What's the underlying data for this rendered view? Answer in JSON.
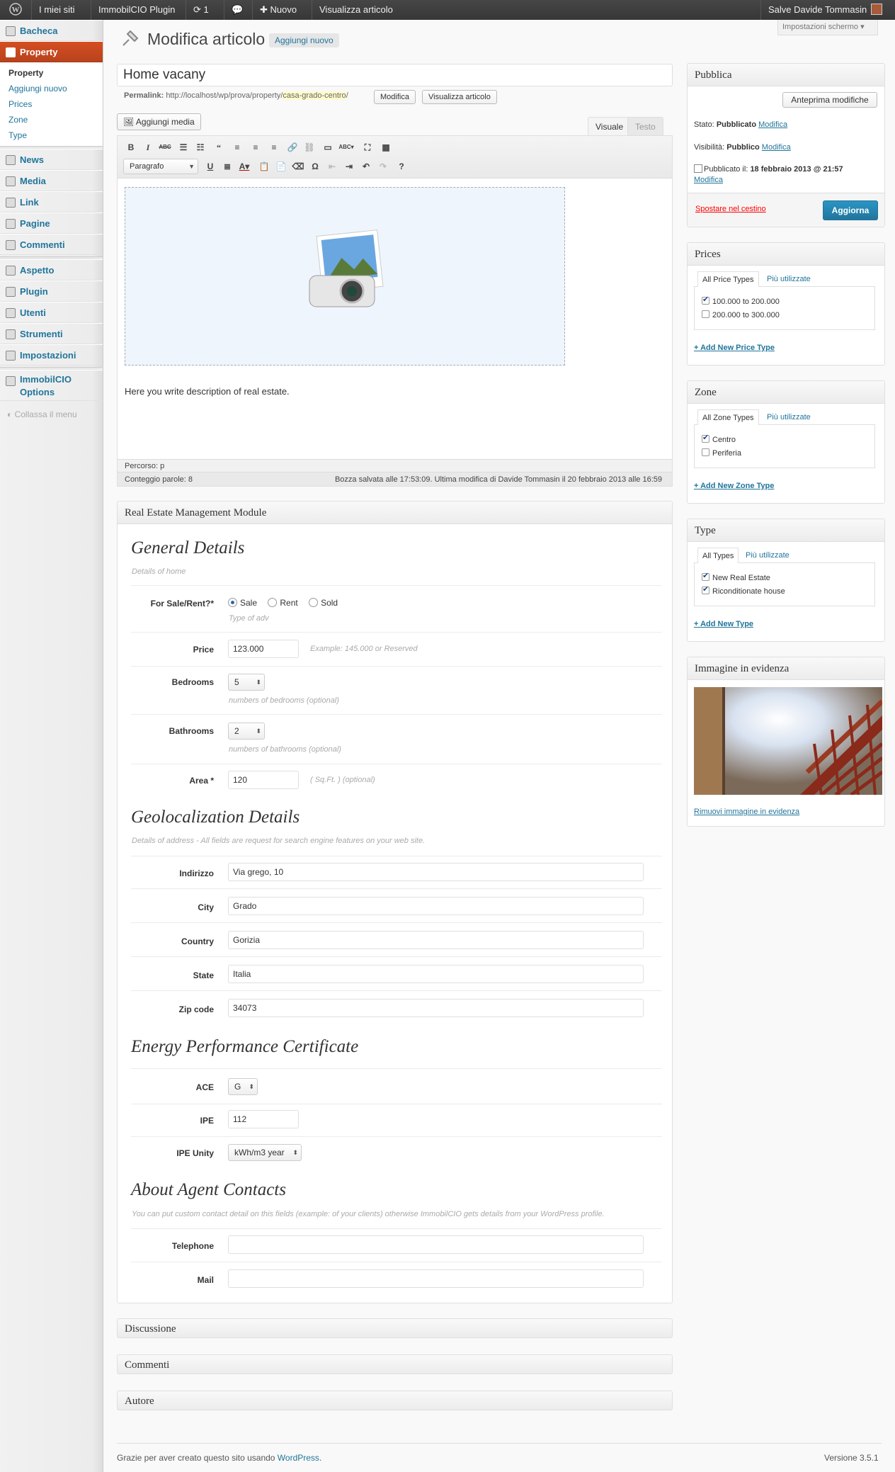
{
  "adminbar": {
    "mysites": "I miei siti",
    "plugin": "ImmobilCIO Plugin",
    "updates": "1",
    "new": "Nuovo",
    "view": "Visualizza articolo",
    "greeting": "Salve Davide Tommasin"
  },
  "screen_options": "Impostazioni schermo",
  "sidebar": {
    "bacheca": "Bacheca",
    "property": "Property",
    "property_sub": [
      "Property",
      "Aggiungi nuovo",
      "Prices",
      "Zone",
      "Type"
    ],
    "items": [
      "News",
      "Media",
      "Link",
      "Pagine",
      "Commenti"
    ],
    "items2": [
      "Aspetto",
      "Plugin",
      "Utenti",
      "Strumenti",
      "Impostazioni"
    ],
    "immobil1": "ImmobilCIO",
    "immobil2": "Options",
    "collapse": "Collassa il menu"
  },
  "page": {
    "title": "Modifica articolo",
    "add_new": "Aggiungi nuovo",
    "post_title": "Home vacany",
    "permalink_label": "Permalink:",
    "permalink_base": "http://localhost/wp/prova/property/",
    "permalink_slug": "casa-grado-centro",
    "permalink_end": "/",
    "edit_btn": "Modifica",
    "view_btn": "Visualizza articolo",
    "add_media": "Aggiungi media",
    "tab_visual": "Visuale",
    "tab_text": "Testo",
    "format": "Paragrafo",
    "content": "Here you write description of real estate.",
    "path": "Percorso: p",
    "wordcount": "Conteggio parole: 8",
    "draft": "Bozza salvata alle 17:53:09. Ultima modifica di Davide Tommasin il 20 febbraio 2013 alle 16:59"
  },
  "rem": {
    "title": "Real Estate Management Module",
    "general": "General Details",
    "general_hint": "Details of home",
    "forsale_label": "For Sale/Rent?*",
    "opt_sale": "Sale",
    "opt_rent": "Rent",
    "opt_sold": "Sold",
    "adv_hint": "Type of adv",
    "price_label": "Price",
    "price": "123.000",
    "price_hint": "Example: 145.000 or Reserved",
    "bedrooms_label": "Bedrooms",
    "bedrooms": "5",
    "bedrooms_hint": "numbers of bedrooms (optional)",
    "bathrooms_label": "Bathrooms",
    "bathrooms": "2",
    "bathrooms_hint": "numbers of bathrooms (optional)",
    "area_label": "Area *",
    "area": "120",
    "area_hint": "( Sq.Ft. ) (optional)",
    "geo": "Geolocalization Details",
    "geo_hint": "Details of address - All fields are request for search engine features on your web site.",
    "indirizzo_label": "Indirizzo",
    "indirizzo": "Via grego, 10",
    "city_label": "City",
    "city": "Grado",
    "country_label": "Country",
    "country": "Gorizia",
    "state_label": "State",
    "state": "Italia",
    "zip_label": "Zip code",
    "zip": "34073",
    "energy": "Energy Performance Certificate",
    "ace_label": "ACE",
    "ace": "G",
    "ipe_label": "IPE",
    "ipe": "112",
    "ipeu_label": "IPE Unity",
    "ipeu": "kWh/m3 year",
    "agent": "About Agent Contacts",
    "agent_hint": "You can put custom contact detail on this fields (example: of your clients) otherwise ImmobilCIO gets details from your WordPress profile.",
    "tel_label": "Telephone",
    "mail_label": "Mail"
  },
  "closed": [
    "Discussione",
    "Commenti",
    "Autore"
  ],
  "publish": {
    "title": "Pubblica",
    "preview": "Anteprima modifiche",
    "stato_label": "Stato:",
    "stato": "Pubblicato",
    "vis_label": "Visibilità:",
    "vis": "Pubblico",
    "modifica": "Modifica",
    "pub_label": "Pubblicato il:",
    "pub_date": "18 febbraio 2013 @ 21:57",
    "trash": "Spostare nel cestino",
    "update": "Aggiorna"
  },
  "prices": {
    "title": "Prices",
    "tab_all": "All Price Types",
    "tab_pop": "Più utilizzate",
    "items": [
      "100.000 to 200.000",
      "200.000 to 300.000"
    ],
    "add": "+ Add New Price Type"
  },
  "zone": {
    "title": "Zone",
    "tab_all": "All Zone Types",
    "tab_pop": "Più utilizzate",
    "items": [
      "Centro",
      "Periferia"
    ],
    "add": "+ Add New Zone Type"
  },
  "type": {
    "title": "Type",
    "tab_all": "All Types",
    "tab_pop": "Più utilizzate",
    "items": [
      "New Real Estate",
      "Riconditionate house"
    ],
    "add": "+ Add New Type"
  },
  "featured": {
    "title": "Immagine in evidenza",
    "remove": "Rimuovi immagine in evidenza"
  },
  "footer": {
    "thanks": "Grazie per aver creato questo sito usando ",
    "wp": "WordPress",
    "dot": ".",
    "version": "Versione 3.5.1"
  }
}
